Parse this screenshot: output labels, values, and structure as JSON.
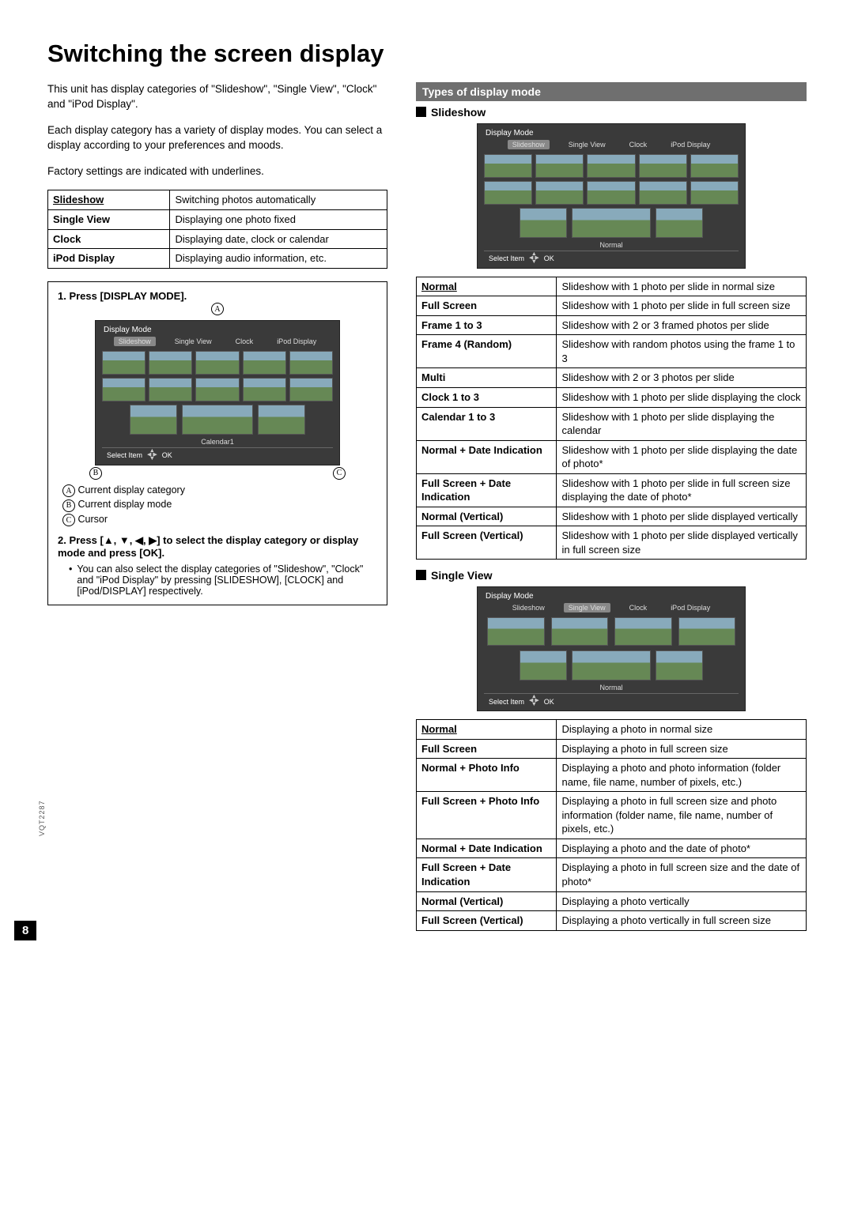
{
  "page": {
    "title": "Switching the screen display",
    "intro1": "This unit has display categories of \"Slideshow\", \"Single View\", \"Clock\" and \"iPod Display\".",
    "intro2": "Each display category has a variety of display modes. You can select a display according to your preferences and moods.",
    "factory_note": "Factory settings are indicated with underlines.",
    "page_number": "8",
    "doc_code": "VQT2287"
  },
  "categories_table": [
    {
      "label": "Slideshow",
      "underline": true,
      "desc": "Switching photos automatically"
    },
    {
      "label": "Single View",
      "underline": false,
      "desc": "Displaying one photo fixed"
    },
    {
      "label": "Clock",
      "underline": false,
      "desc": "Displaying date, clock or calendar"
    },
    {
      "label": "iPod Display",
      "underline": false,
      "desc": "Displaying audio information, etc."
    }
  ],
  "box": {
    "step1_label": "1.  Press [DISPLAY MODE].",
    "marker_a": "A",
    "marker_b": "B",
    "marker_c": "C",
    "legend_a": "Current display category",
    "legend_b": "Current display mode",
    "legend_c": "Cursor",
    "step2_label": "2.  Press [▲, ▼, ◀, ▶] to select the display category or display mode and press [OK].",
    "step2_note": "You can also select the display categories of \"Slideshow\", \"Clock\" and \"iPod Display\" by pressing [SLIDESHOW], [CLOCK] and [iPod/DISPLAY] respectively.",
    "screen_mode_label": "Calendar1"
  },
  "screen_common": {
    "title": "Display Mode",
    "tabs": [
      "Slideshow",
      "Single View",
      "Clock",
      "iPod Display"
    ],
    "select_item": "Select Item",
    "ok": "OK",
    "normal_label": "Normal"
  },
  "types_section": {
    "header": "Types of display mode",
    "slideshow_heading": "Slideshow",
    "singleview_heading": "Single View"
  },
  "slideshow_table": [
    {
      "label": "Normal",
      "underline": true,
      "desc": "Slideshow with 1 photo per slide in normal size"
    },
    {
      "label": "Full Screen",
      "underline": false,
      "desc": "Slideshow with 1 photo per slide in full screen size"
    },
    {
      "label": "Frame 1 to 3",
      "underline": false,
      "desc": "Slideshow with 2 or 3 framed photos per slide"
    },
    {
      "label": "Frame 4 (Random)",
      "underline": false,
      "desc": "Slideshow with random photos using the frame 1 to 3"
    },
    {
      "label": "Multi",
      "underline": false,
      "desc": "Slideshow with 2 or 3 photos per slide"
    },
    {
      "label": "Clock 1 to 3",
      "underline": false,
      "desc": "Slideshow with 1 photo per slide displaying the clock"
    },
    {
      "label": "Calendar 1 to 3",
      "underline": false,
      "desc": "Slideshow with 1 photo per slide displaying the calendar"
    },
    {
      "label": "Normal + Date Indication",
      "underline": false,
      "desc": "Slideshow with 1 photo per slide displaying the date of photo*"
    },
    {
      "label": "Full Screen + Date Indication",
      "underline": false,
      "desc": "Slideshow with 1 photo per slide in full screen size displaying the date of photo*"
    },
    {
      "label": "Normal (Vertical)",
      "underline": false,
      "desc": "Slideshow with 1 photo per slide displayed vertically"
    },
    {
      "label": "Full Screen (Vertical)",
      "underline": false,
      "desc": "Slideshow with 1 photo per slide displayed vertically in full screen size"
    }
  ],
  "singleview_table": [
    {
      "label": "Normal",
      "underline": true,
      "desc": "Displaying a photo in normal size"
    },
    {
      "label": "Full Screen",
      "underline": false,
      "desc": "Displaying a photo in full screen size"
    },
    {
      "label": "Normal + Photo Info",
      "underline": false,
      "desc": "Displaying a photo and photo information (folder name, file name, number of pixels, etc.)"
    },
    {
      "label": "Full Screen + Photo Info",
      "underline": false,
      "desc": "Displaying a photo in full screen size and photo information (folder name, file name, number of pixels, etc.)"
    },
    {
      "label": "Normal + Date Indication",
      "underline": false,
      "desc": "Displaying a photo and the date of photo*"
    },
    {
      "label": "Full Screen + Date Indication",
      "underline": false,
      "desc": "Displaying a photo in full screen size and the date of photo*"
    },
    {
      "label": "Normal (Vertical)",
      "underline": false,
      "desc": "Displaying a photo vertically"
    },
    {
      "label": "Full Screen (Vertical)",
      "underline": false,
      "desc": "Displaying a photo vertically in full screen size"
    }
  ]
}
